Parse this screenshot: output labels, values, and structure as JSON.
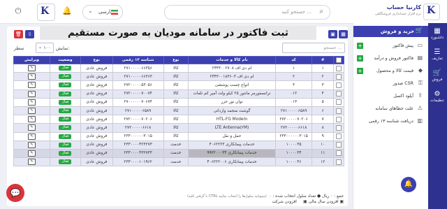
{
  "topbar": {
    "search_placeholder": "جستجو کنید ...",
    "language": "فارسی",
    "brand_name": "کارنیا حساب",
    "brand_sub": "نرم افزار حسابداری فروشگاهی",
    "brand_logo_letter": "K",
    "user_logo_letter": "K"
  },
  "rail": {
    "items": [
      {
        "label": "داشبورد",
        "icon": "dashboard-icon",
        "glyph": "▦"
      },
      {
        "label": "تعاریف",
        "icon": "definitions-icon",
        "glyph": "☰"
      },
      {
        "label": "فروش",
        "icon": "sales-icon",
        "glyph": "🛒"
      },
      {
        "label": "تنظیمات",
        "icon": "settings-icon",
        "glyph": "⚙"
      }
    ]
  },
  "sidebar": {
    "header": "خرید و فروش",
    "items": [
      {
        "label": "پیش فاکتور",
        "has_plus": true
      },
      {
        "label": "فاکتور فروش و درآمد",
        "has_plus": true
      },
      {
        "label": "قیمت کالا و محصول",
        "has_plus": true
      },
      {
        "label": "صدور CSR",
        "has_plus": false
      },
      {
        "label": "آپلود اکسل",
        "has_plus": false
      },
      {
        "label": "علت خطاهای سامانه",
        "has_plus": false
      },
      {
        "label": "دریافت شناسه ۱۳ رقمی",
        "has_plus": false
      }
    ]
  },
  "page": {
    "title": "ثبت فاکتور در سامانه مودیان به صورت مستقیم",
    "search_placeholder": "جستجو ...",
    "show_label": "نمایش:",
    "page_size": "۱۰۰",
    "row_label": "سطر"
  },
  "table": {
    "headers": [
      "#",
      "کد",
      "نام کالا و خدمات",
      "نوع",
      "شناسه ۱۳ رقمی",
      "نوع",
      "وضعیت",
      "ویرایش"
    ],
    "rows": [
      {
        "num": "۱",
        "code": "۱",
        "name": "ام دی اف ۲۴۴۳۰۰۲۷۰۸",
        "kind": "کالا",
        "id13": "۲۷۱۰۰۰۰۰۶۶۳۵۶",
        "type": "فروش عادی",
        "status": "فعال"
      },
      {
        "num": "۲",
        "code": "۲",
        "name": "ام دی اف ۲۴۴۳۰۰۱۸۳۶۰۳",
        "kind": "کالا",
        "id13": "۲۷۱۰۰۰۰۰۶۶۳۶۳",
        "type": "فروش عادی",
        "status": "فعال"
      },
      {
        "num": "۳",
        "code": "۳",
        "name": "انواع چسب پوششی",
        "kind": "کالا",
        "id13": "۲۷۲۰۰۰۰۰۵۳۰۵۶",
        "type": "فروش عادی",
        "status": "فعال"
      },
      {
        "num": "۴",
        "code": "۰۱۲",
        "name": "ترانسفورمر مانتور ۲۵ کیلو ولت آمپر کم تلفات",
        "kind": "کالا",
        "id13": "۲۷۲۰۰۰۰۰۷۰۰۷۴",
        "type": "فروش عادی",
        "status": "فعال"
      },
      {
        "num": "۵",
        "code": "۰۱۳",
        "name": "توان نور حزر",
        "kind": "کالا",
        "id13": "۲۷۰۰۰۰۰۰۷۰۶۷۴",
        "type": "فروش عادی",
        "status": "فعال"
      },
      {
        "num": "۶",
        "code": "۲۷۱۰۰۰۰۰۶۵۸۹",
        "name": "گوشت منجمد وارداتی",
        "kind": "کالا",
        "id13": "۲۷۱۰۰۰۰۰۶۵۸۹",
        "type": "فروش عادی",
        "status": "فعال"
      },
      {
        "num": "۷",
        "code": "۲۷۲۰۰۰۰۰۷۰۲۰۶",
        "name": "HTL-FG Modem",
        "kind": "کالا",
        "id13": "۲۷۲۰۰۰۰۰۷۰۲۰۶",
        "type": "فروش عادی",
        "status": "فعال"
      },
      {
        "num": "۸",
        "code": "۲۷۲۰۰۰۰۰۶۶۱۸",
        "name": "LTE Antenna(۲M)",
        "kind": "کالا",
        "id13": "۲۷۲۰۰۰۰۰۶۶۱۸",
        "type": "فروش عادی",
        "status": "فعال"
      },
      {
        "num": "۹",
        "code": "۲۳۳۰۰۰۰۰۰۳۰۱۵",
        "name": "حمل و نقل",
        "kind": "کالا",
        "id13": "۲۳۳۰۰۰۰۰۰۳۰۱۵",
        "type": "فروش عادی",
        "status": "فعال"
      },
      {
        "num": "۱۰",
        "code": "۱۰۰۰۰۳۵",
        "name": "خدمات پیمانکاری ۴۰۶۲۲۲۳",
        "kind": "خدمت",
        "id13": "۲۳۳۰۰۰۰۴۲۳۲۷۳",
        "type": "فروش عادی",
        "status": "فعال"
      },
      {
        "num": "۱۱",
        "code": "۱۰۰۰۰۳۴",
        "name": "خدمات پیمانکاری ۹۹۲۲۰۰۰۳۴",
        "kind": "خدمت",
        "id13": "۲۳۳۰۰۰۰۴۳۲۷۳۳",
        "type": "فروش عادی",
        "status": "فعال"
      },
      {
        "num": "۱۲",
        "code": "۱۰۰۰۰۳۶",
        "name": "خدمات پیمانکاری ۴۰۶۲۲۲۰۰۶",
        "kind": "خدمت",
        "id13": "۲۳۳۰۰۰۰۱۰۱۹۶۲",
        "type": "فروش عادی",
        "status": "فعال"
      }
    ]
  },
  "footer": {
    "line1": "جمع : ۰ ریال  ●  تعداد سلول انتخاب شده : ۰",
    "line1_hint": "(با گرفتن کلید CTRL میتوانید سلول‌ها را انتخاب نمایید)",
    "line2_a": "افزودن شرکت",
    "line2_b": "افزودن سال مالی"
  },
  "colors": {
    "primary": "#3b3fb0",
    "rail": "#2f3190",
    "accent_green": "#27a844",
    "accent_red": "#d9343a"
  }
}
